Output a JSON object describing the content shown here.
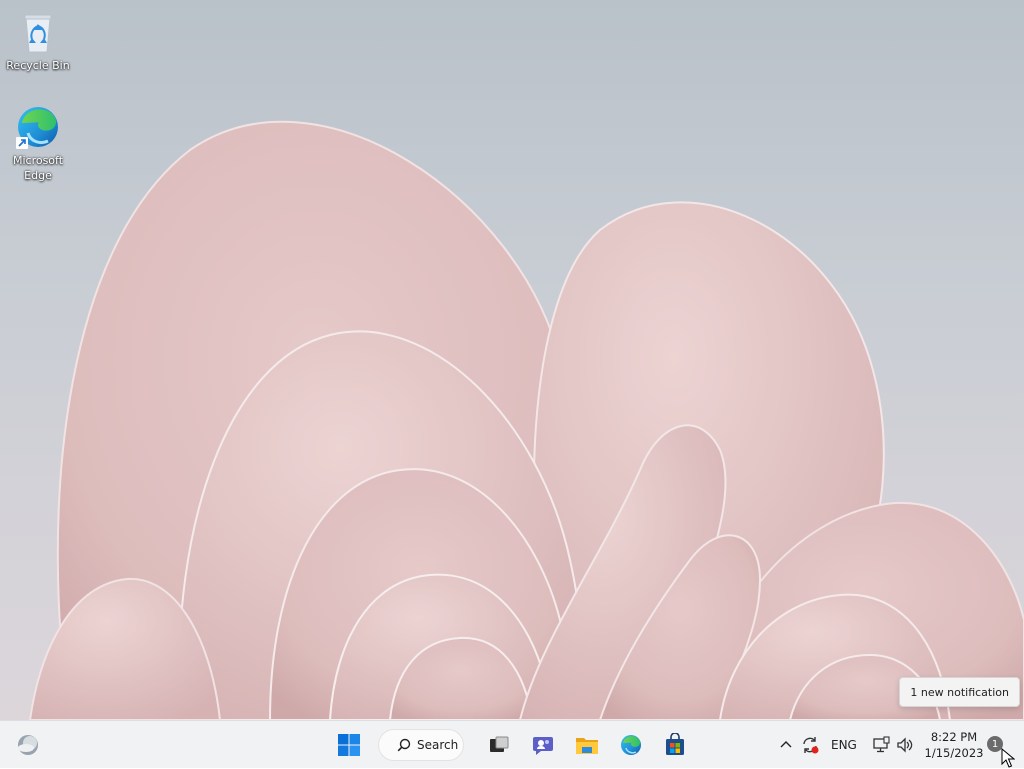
{
  "desktop": {
    "icons": [
      {
        "label": "Recycle Bin",
        "icon": "recycle-bin-icon"
      },
      {
        "label": "Microsoft\nEdge",
        "icon": "edge-icon"
      }
    ]
  },
  "notification_toast": {
    "text": "1 new notification"
  },
  "taskbar": {
    "widgets_icon": "weather-widget-icon",
    "start_icon": "windows-start-icon",
    "search_label": "Search",
    "pinned": [
      {
        "name": "task-view",
        "icon": "task-view-icon"
      },
      {
        "name": "teams-chat",
        "icon": "chat-icon"
      },
      {
        "name": "file-explorer",
        "icon": "folder-icon"
      },
      {
        "name": "edge",
        "icon": "edge-icon"
      },
      {
        "name": "store",
        "icon": "store-icon"
      }
    ],
    "tray": {
      "language": "ENG",
      "time": "8:22 PM",
      "date": "1/15/2023",
      "notification_count": "1"
    }
  },
  "colors": {
    "accent_blue": "#0067c0",
    "taskbar_bg": "#f0f2f4"
  }
}
